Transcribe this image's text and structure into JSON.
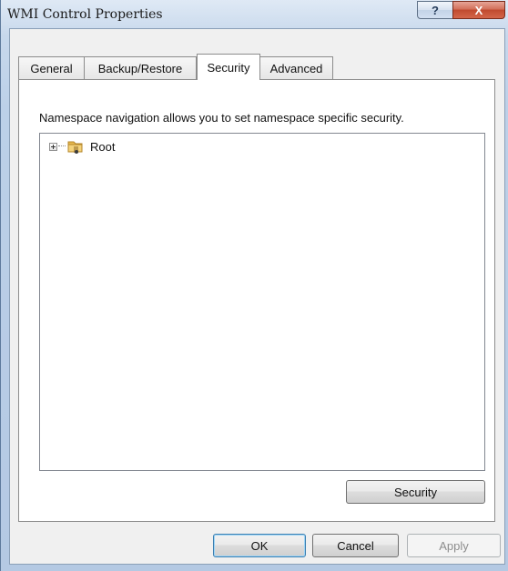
{
  "window": {
    "title": "WMI Control Properties",
    "help_label": "?",
    "close_label": "X"
  },
  "tabs": [
    {
      "label": "General",
      "active": false
    },
    {
      "label": "Backup/Restore",
      "active": false
    },
    {
      "label": "Security",
      "active": true
    },
    {
      "label": "Advanced",
      "active": false
    }
  ],
  "security_tab": {
    "description": "Namespace navigation allows you to set namespace specific security.",
    "tree": {
      "root": {
        "label": "Root",
        "expanded": false,
        "icon": "folder-icon"
      }
    },
    "security_button": "Security"
  },
  "footer": {
    "ok": "OK",
    "cancel": "Cancel",
    "apply": "Apply"
  },
  "colors": {
    "accent": "#3c7fb1",
    "close": "#c04a2f",
    "folder": "#e9b94f"
  }
}
